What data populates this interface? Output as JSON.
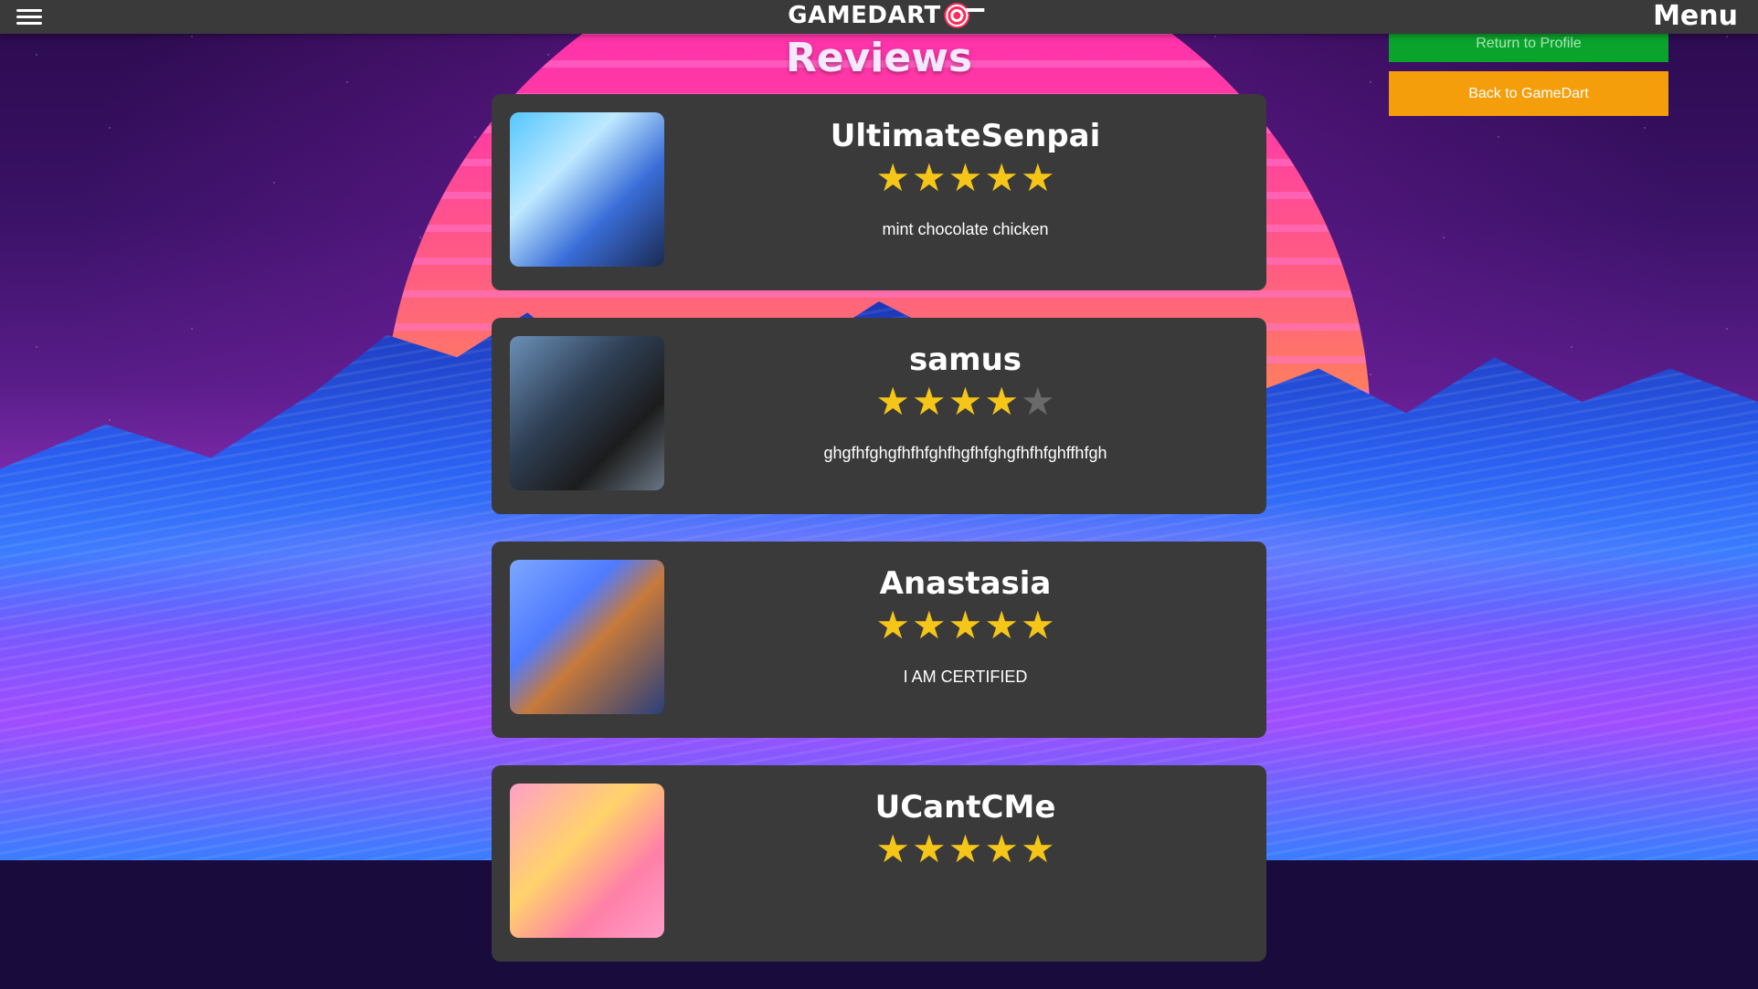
{
  "header": {
    "logo_text": "GAMEDART",
    "menu_label": "Menu"
  },
  "side_buttons": {
    "return_profile_label": "Return to Profile",
    "back_to_gamedart_label": "Back to GameDart"
  },
  "page": {
    "title": "Reviews"
  },
  "reviews": [
    {
      "username": "UltimateSenpai",
      "rating": 5,
      "max_rating": 5,
      "text": "mint chocolate chicken"
    },
    {
      "username": "samus",
      "rating": 4,
      "max_rating": 5,
      "text": "ghgfhfghgfhfhfghfhgfhfghgfhfhfghffhfgh"
    },
    {
      "username": "Anastasia",
      "rating": 5,
      "max_rating": 5,
      "text": "I AM CERTIFIED"
    },
    {
      "username": "UCantCMe",
      "rating": 5,
      "max_rating": 5,
      "text": ""
    }
  ],
  "colors": {
    "topbar": "#3a3a3a",
    "card": "#3a3a3a",
    "star_on": "#f5c518",
    "star_off": "#6a6a6a",
    "return_button": "#0aa32c",
    "back_button": "#f59e0b"
  },
  "icons": {
    "hamburger": "hamburger-icon",
    "logo": "target-icon",
    "star": "star-icon"
  }
}
